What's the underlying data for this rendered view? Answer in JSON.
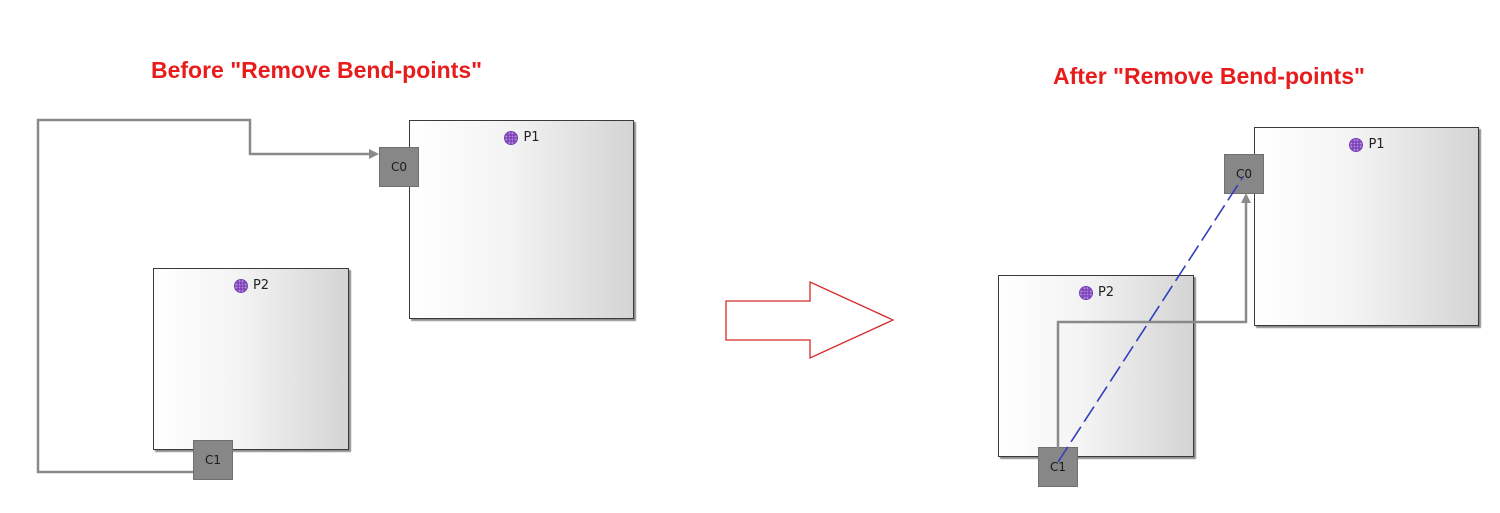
{
  "before": {
    "title": "Before \"Remove Bend-points\"",
    "title_color": "#e81c1c",
    "parts": {
      "p1": "P1",
      "p2": "P2"
    },
    "ports": {
      "c0": "C0",
      "c1": "C1"
    }
  },
  "after": {
    "title": "After \"Remove Bend-points\"",
    "title_color": "#e81c1c",
    "parts": {
      "p1": "P1",
      "p2": "P2"
    },
    "ports": {
      "c0": "C0",
      "c1": "C1"
    }
  },
  "colors": {
    "connector": "#8a8a8a",
    "straight_connector": "#2f3fbf",
    "arrow_outline": "#d42a2a",
    "part_icon": "#8a4fc7"
  },
  "icons": {
    "part_icon": "purple-grid-icon",
    "transition_arrow": "right-arrow-outline"
  }
}
